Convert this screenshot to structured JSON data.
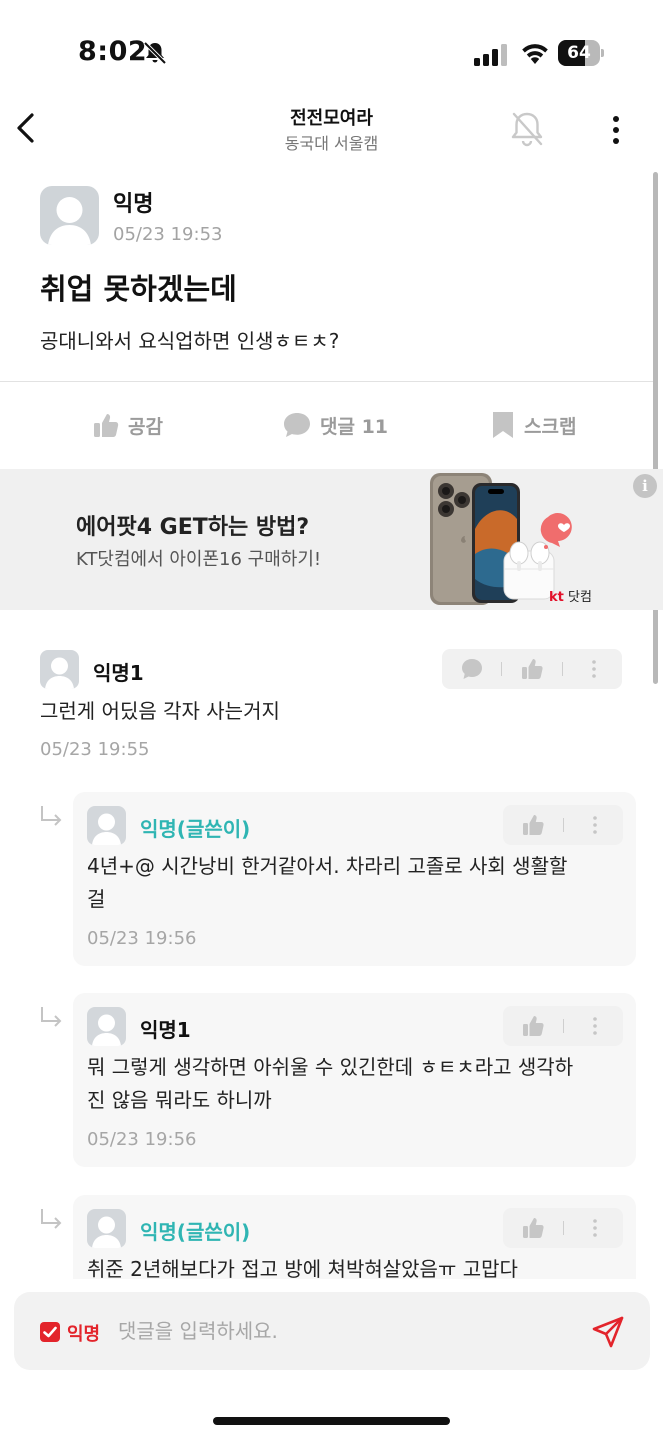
{
  "status_bar": {
    "time": "8:02",
    "battery": "64",
    "battery_level": 0.64
  },
  "header": {
    "title": "전전모여라",
    "subtitle": "동국대 서울캠"
  },
  "post": {
    "author": "익명",
    "time": "05/23 19:53",
    "title": "취업 못하겠는데",
    "body": "공대니와서 요식업하면 인생ㅎㅌㅊ?",
    "actions": {
      "like": "공감",
      "comment": "댓글 11",
      "scrap": "스크랩"
    }
  },
  "ad": {
    "title": "에어팟4 GET하는 방법?",
    "subtitle": "KT닷컴에서 아이폰16 구매하기!",
    "info": "i",
    "brand_kt": "kt",
    "brand_rest": " 닷컴"
  },
  "comments": [
    {
      "author": "익명1",
      "text": "그런게 어딨음 각자 사는거지",
      "time": "05/23 19:55"
    }
  ],
  "replies": [
    {
      "author": "익명(글쓴이)",
      "text": "4년+@ 시간낭비 한거같아서. 차라리 고졸로 사회 생활할걸",
      "time": "05/23 19:56"
    },
    {
      "author": "익명1",
      "text": "뭐 그렇게 생각하면 아쉬울 수 있긴한데 ㅎㅌㅊ라고 생각하진 않음 뭐라도 하니까",
      "time": "05/23 19:56"
    },
    {
      "author": "익명(글쓴이)",
      "text": "취준 2년해보다가 접고 방에 쳐박혀살았음ㅠ 고맙다"
    }
  ],
  "input": {
    "anon_label": "익명",
    "placeholder": "댓글을 입력하세요."
  },
  "colors": {
    "writer": "#2fb5b3",
    "accent_red": "#e3242b"
  }
}
